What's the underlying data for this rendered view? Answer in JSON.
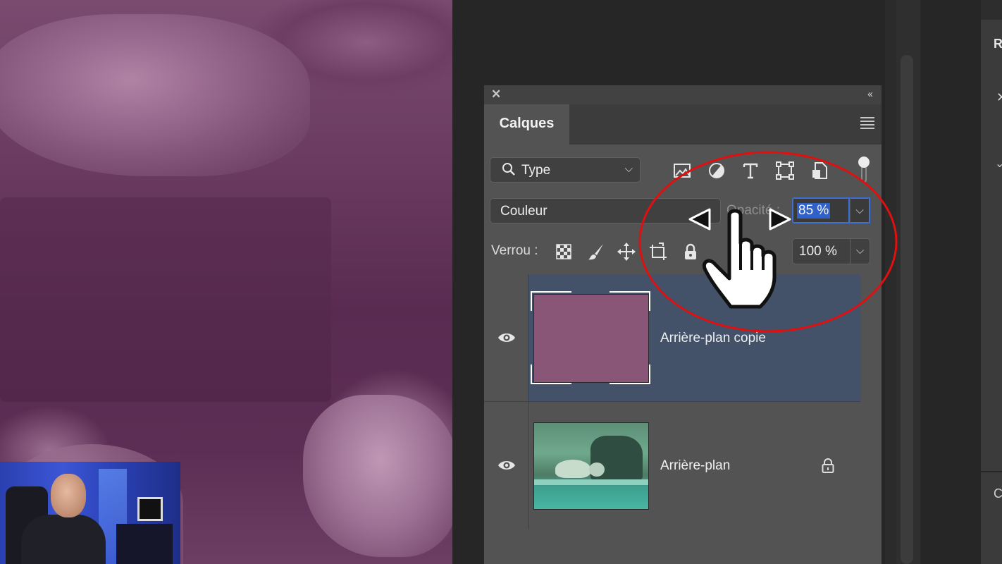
{
  "panel": {
    "tab_label": "Calques",
    "filter": {
      "label": "Type"
    },
    "blend_mode": "Couleur",
    "opacity": {
      "label": "Opacité :",
      "value": "85 %"
    },
    "lock": {
      "label": "Verrou :"
    },
    "fill": {
      "value": "100 %"
    },
    "layers": [
      {
        "name": "Arrière-plan copie",
        "selected": true,
        "thumbnail_color": "#8a5678"
      },
      {
        "name": "Arrière-plan",
        "selected": false,
        "locked": true
      }
    ]
  },
  "sidebar": {
    "letter": "R",
    "bottom_letter": "C"
  },
  "colors": {
    "selection": "#435169",
    "annotation": "#e01010",
    "accent": "#3c6fd1"
  }
}
